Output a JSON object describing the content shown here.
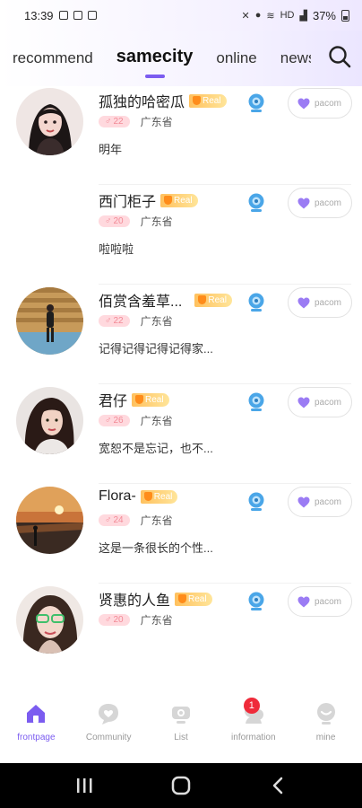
{
  "status_bar": {
    "time": "13:39",
    "signal": "HD",
    "battery": "37%"
  },
  "tabs": [
    {
      "label": "recommend",
      "active": false
    },
    {
      "label": "samecity",
      "active": true
    },
    {
      "label": "online",
      "active": false
    },
    {
      "label": "news",
      "active": false
    }
  ],
  "users": [
    {
      "name": "孤独的哈密瓜",
      "badge": "Real",
      "age": "22",
      "location": "广东省",
      "signature": "明年",
      "like_label": "pacom"
    },
    {
      "name": "西门柜子",
      "badge": "Real",
      "age": "20",
      "location": "广东省",
      "signature": "啦啦啦",
      "like_label": "pacom"
    },
    {
      "name": "佰赏含羞草...",
      "badge": "Real",
      "age": "22",
      "location": "广东省",
      "signature": "记得记得记得记得家...",
      "like_label": "pacom"
    },
    {
      "name": "君仔",
      "badge": "Real",
      "age": "26",
      "location": "广东省",
      "signature": "宽恕不是忘记，也不...",
      "like_label": "pacom"
    },
    {
      "name": "Flora-",
      "badge": "Real",
      "age": "24",
      "location": "广东省",
      "signature": "这是一条很长的个性...",
      "like_label": "pacom"
    },
    {
      "name": "贤惠的人鱼",
      "badge": "Real",
      "age": "20",
      "location": "广东省",
      "signature": "",
      "like_label": "pacom"
    }
  ],
  "bottom_nav": [
    {
      "label": "frontpage",
      "icon": "home-icon",
      "active": true
    },
    {
      "label": "Community",
      "icon": "community-icon",
      "active": false
    },
    {
      "label": "List",
      "icon": "list-icon",
      "active": false
    },
    {
      "label": "information",
      "icon": "information-icon",
      "active": false,
      "badge": "1"
    },
    {
      "label": "mine",
      "icon": "mine-icon",
      "active": false
    }
  ],
  "colors": {
    "accent": "#7b5cf0",
    "real_badge": "#ffc15e",
    "age_badge": "#ffd9de",
    "heart": "#9b7cf4",
    "notification": "#ef2b3a"
  }
}
